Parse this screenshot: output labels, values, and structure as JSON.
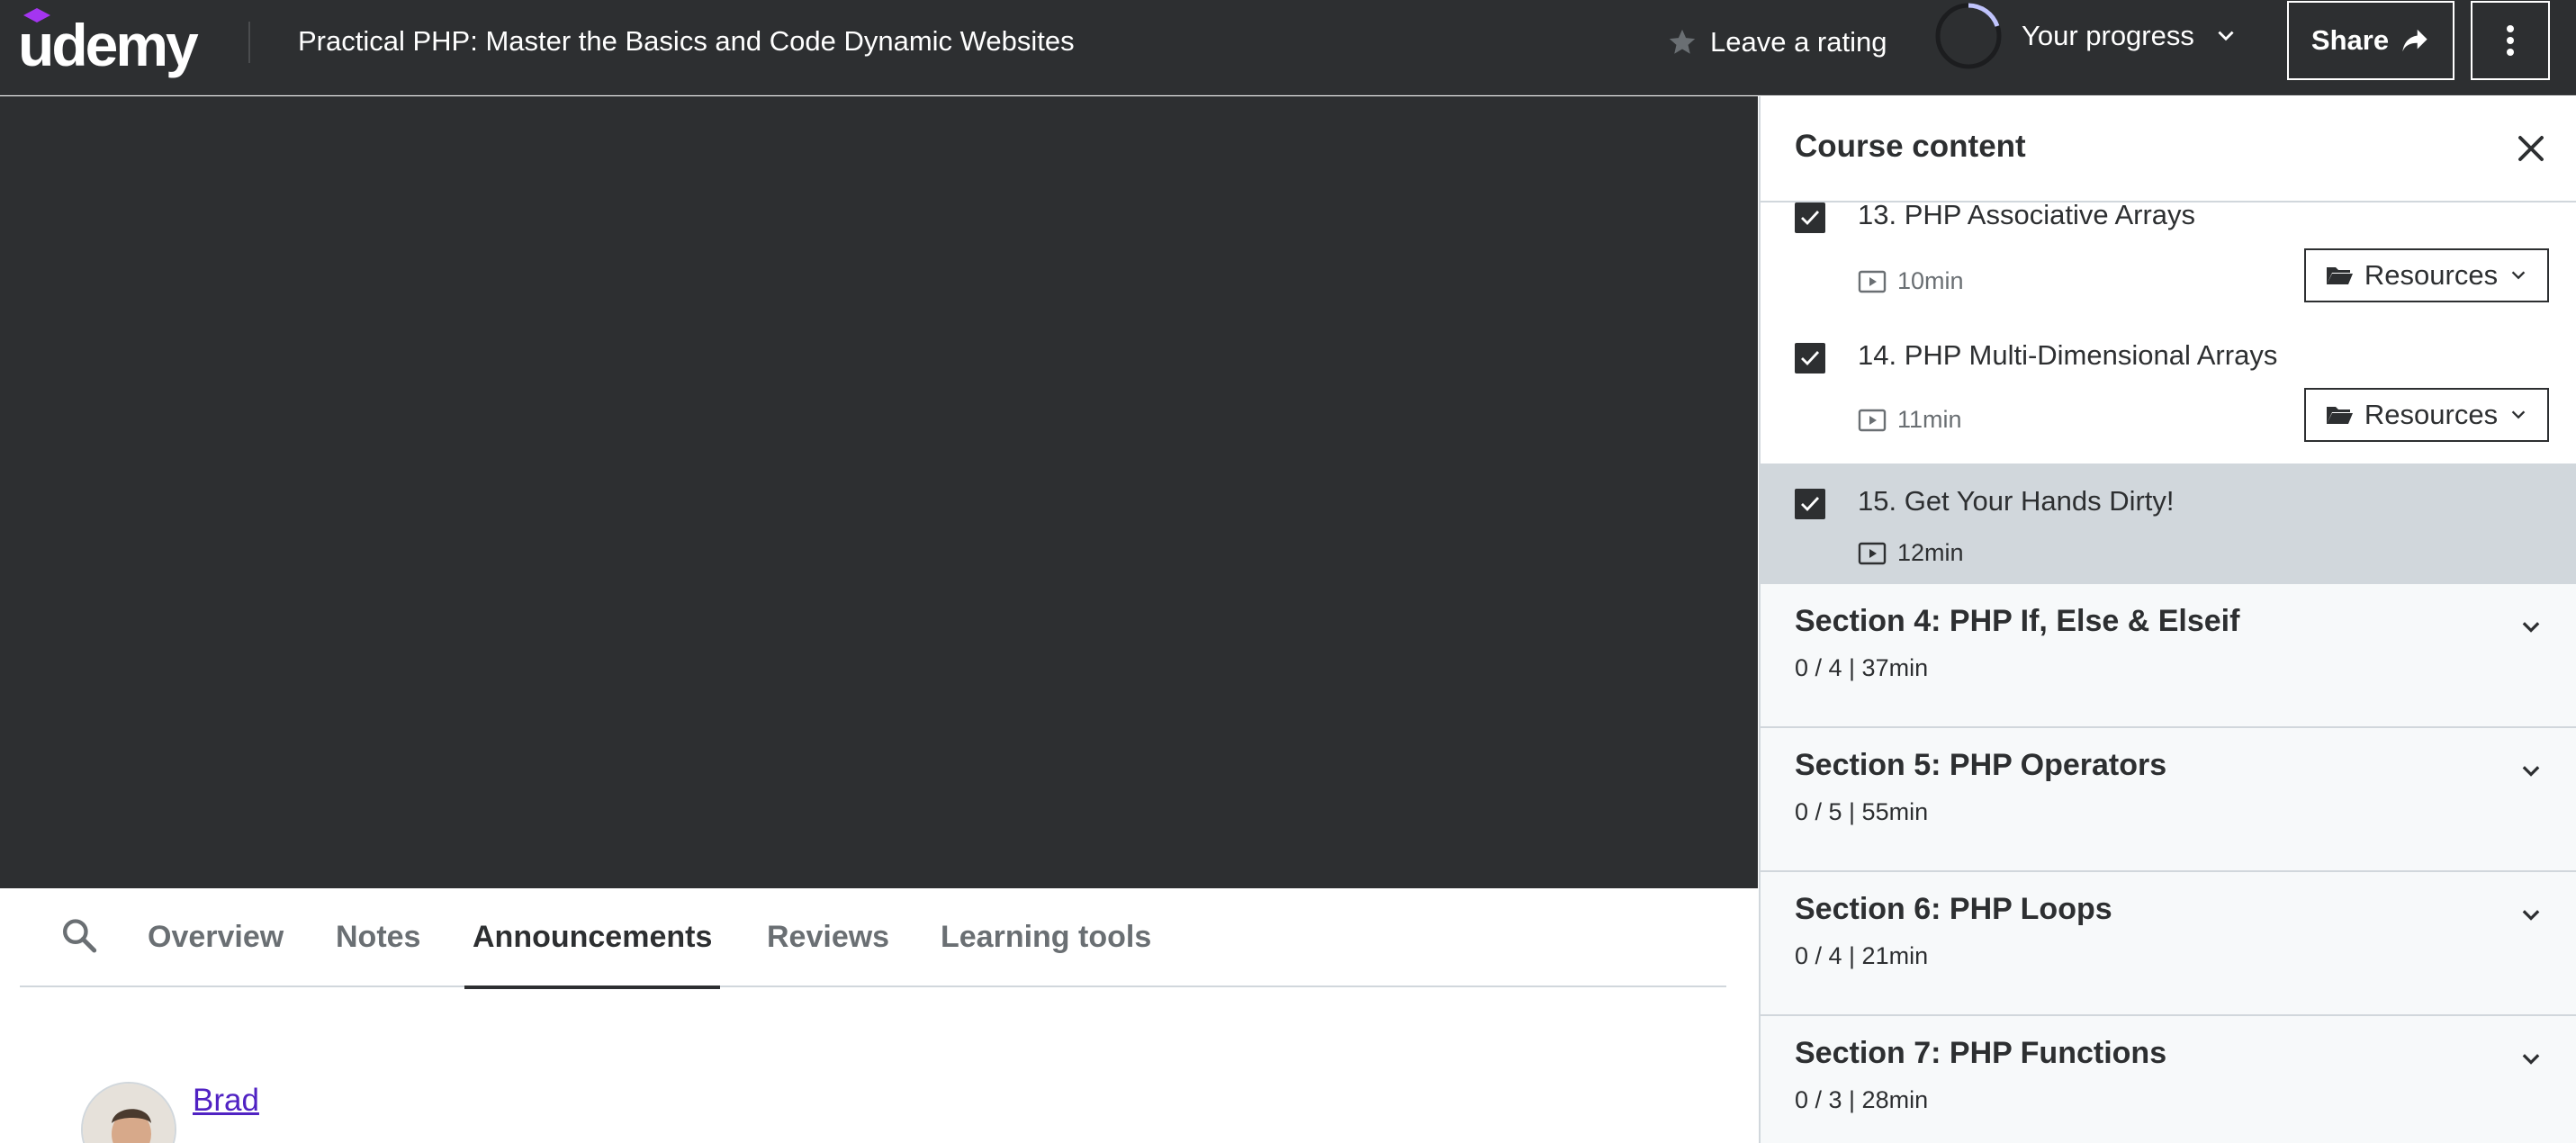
{
  "header": {
    "logo_text": "udemy",
    "course_title": "Practical PHP: Master the Basics and Code Dynamic Websites",
    "rating_label": "Leave a rating",
    "progress_label": "Your progress",
    "share_label": "Share"
  },
  "tabs": [
    {
      "label": "Overview",
      "active": false
    },
    {
      "label": "Notes",
      "active": false
    },
    {
      "label": "Announcements",
      "active": true
    },
    {
      "label": "Reviews",
      "active": false
    },
    {
      "label": "Learning tools",
      "active": false
    }
  ],
  "announcement": {
    "author": "Brad"
  },
  "sidebar": {
    "title": "Course content",
    "lectures": [
      {
        "title": "13. PHP Associative Arrays",
        "duration": "10min",
        "resources_label": "Resources",
        "completed": true
      },
      {
        "title": "14. PHP Multi-Dimensional Arrays",
        "duration": "11min",
        "resources_label": "Resources",
        "completed": true
      },
      {
        "title": "15. Get Your Hands Dirty!",
        "duration": "12min",
        "completed": true,
        "current": true
      }
    ],
    "sections": [
      {
        "title": "Section 4: PHP If, Else & Elseif",
        "meta": "0 / 4 | 37min"
      },
      {
        "title": "Section 5: PHP Operators",
        "meta": "0 / 5 | 55min"
      },
      {
        "title": "Section 6: PHP Loops",
        "meta": "0 / 4 | 21min"
      },
      {
        "title": "Section 7: PHP Functions",
        "meta": "0 / 3 | 28min"
      }
    ]
  },
  "colors": {
    "header_bg": "#2d2f31",
    "brand_purple": "#a435f0",
    "link_purple": "#5022c3",
    "current_lecture_bg": "#d1d7dc",
    "section_bg": "#f7f9fa"
  }
}
